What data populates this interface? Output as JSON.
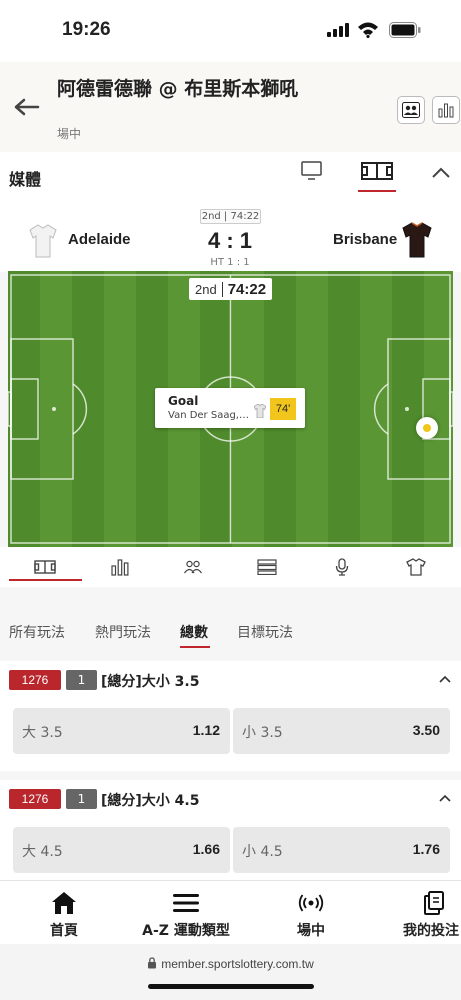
{
  "status": {
    "time": "19:26"
  },
  "header": {
    "title": "阿德雷德聯 @ 布里斯本獅吼",
    "subtitle": "場中"
  },
  "media": {
    "label": "媒體"
  },
  "match": {
    "period": "2nd | 74:22",
    "home_team": "Adelaide",
    "away_team": "Brisbane",
    "score": "4 : 1",
    "halftime": "HT 1 : 1"
  },
  "pitch": {
    "clock_period": "2nd",
    "clock_time": "74:22",
    "event_title": "Goal",
    "event_player": "Van Der Saag, ...",
    "event_minute": "74'"
  },
  "market_tabs": [
    "所有玩法",
    "熱門玩法",
    "總數",
    "目標玩法"
  ],
  "markets": [
    {
      "id": "1276",
      "num": "1",
      "name": "[總分]大小 3.5",
      "selections": [
        {
          "label": "大 3.5",
          "odds": "1.12"
        },
        {
          "label": "小 3.5",
          "odds": "3.50"
        }
      ]
    },
    {
      "id": "1276",
      "num": "1",
      "name": "[總分]大小 4.5",
      "selections": [
        {
          "label": "大 4.5",
          "odds": "1.66"
        },
        {
          "label": "小 4.5",
          "odds": "1.76"
        }
      ]
    }
  ],
  "bottom_nav": [
    {
      "label": "首頁",
      "icon": "home-icon"
    },
    {
      "label": "A-Z 運動類型",
      "icon": "menu-icon"
    },
    {
      "label": "場中",
      "icon": "live-icon"
    },
    {
      "label": "我的投注",
      "icon": "bets-icon"
    }
  ],
  "browser": {
    "url": "member.sportslottery.com.tw"
  },
  "colors": {
    "accent": "#c0272d",
    "pitch": "#56912f",
    "minute_badge": "#f2c51d"
  }
}
